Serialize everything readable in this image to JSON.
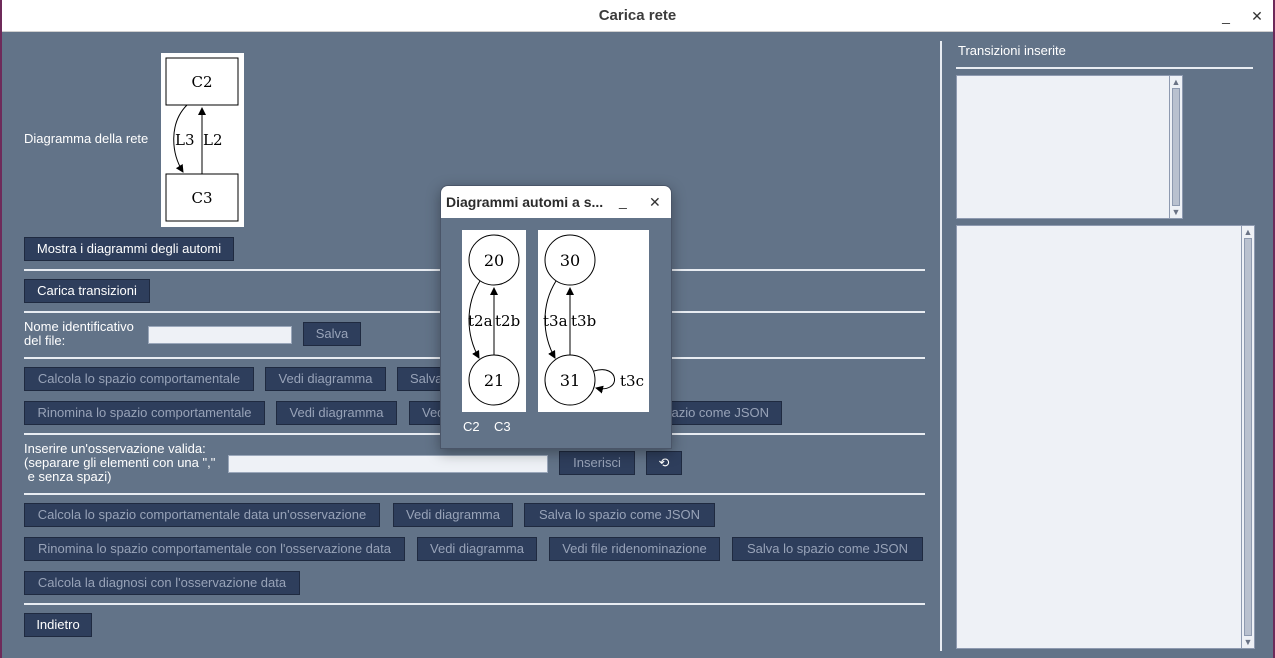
{
  "window": {
    "title": "Carica rete",
    "minimize_glyph": "_",
    "close_glyph": "✕"
  },
  "network": {
    "label": "Diagramma della rete",
    "nodes": [
      "C2",
      "C3"
    ],
    "edges": [
      "L3",
      "L2"
    ]
  },
  "buttons": {
    "show_automata": "Mostra i diagrammi degli automi",
    "load_transitions": "Carica transizioni",
    "save": "Salva",
    "compute_space": "Calcola lo spazio comportamentale",
    "view_diagram": "Vedi diagramma",
    "save_partial": "Salva",
    "rename_space": "Rinomina lo spazio comportamentale",
    "view_diagram2": "Vedi diagramma",
    "view_partial": "Ved",
    "save_json_partial": "pazio come JSON",
    "insert": "Inserisci",
    "reset_glyph": "⟲",
    "compute_obs": "Calcola lo spazio comportamentale data un'osservazione",
    "view_diagram3": "Vedi diagramma",
    "save_json": "Salva lo spazio come JSON",
    "rename_obs": "Rinomina lo spazio comportamentale con l'osservazione data",
    "view_diagram4": "Vedi diagramma",
    "view_rename_file": "Vedi file ridenominazione",
    "save_json2": "Salva lo spazio come JSON",
    "diagnosis": "Calcola la diagnosi con l'osservazione data",
    "back": "Indietro"
  },
  "fields": {
    "file_name_label": "Nome identificativo\ndel file:",
    "file_name_value": "",
    "observation_label": "Inserire un'osservazione valida:\n(separare gli elementi con una \",\"\n e senza spazi)",
    "observation_value": ""
  },
  "side_panel": {
    "title": "Transizioni inserite"
  },
  "popup": {
    "title": "Diagrammi automi a s...",
    "minimize_glyph": "_",
    "close_glyph": "✕",
    "automaton_c2": {
      "name": "C2",
      "states": [
        "20",
        "21"
      ],
      "transitions": [
        "t2a",
        "t2b"
      ]
    },
    "automaton_c3": {
      "name": "C3",
      "states": [
        "30",
        "31"
      ],
      "transitions": [
        "t3a",
        "t3b",
        "t3c"
      ]
    }
  }
}
